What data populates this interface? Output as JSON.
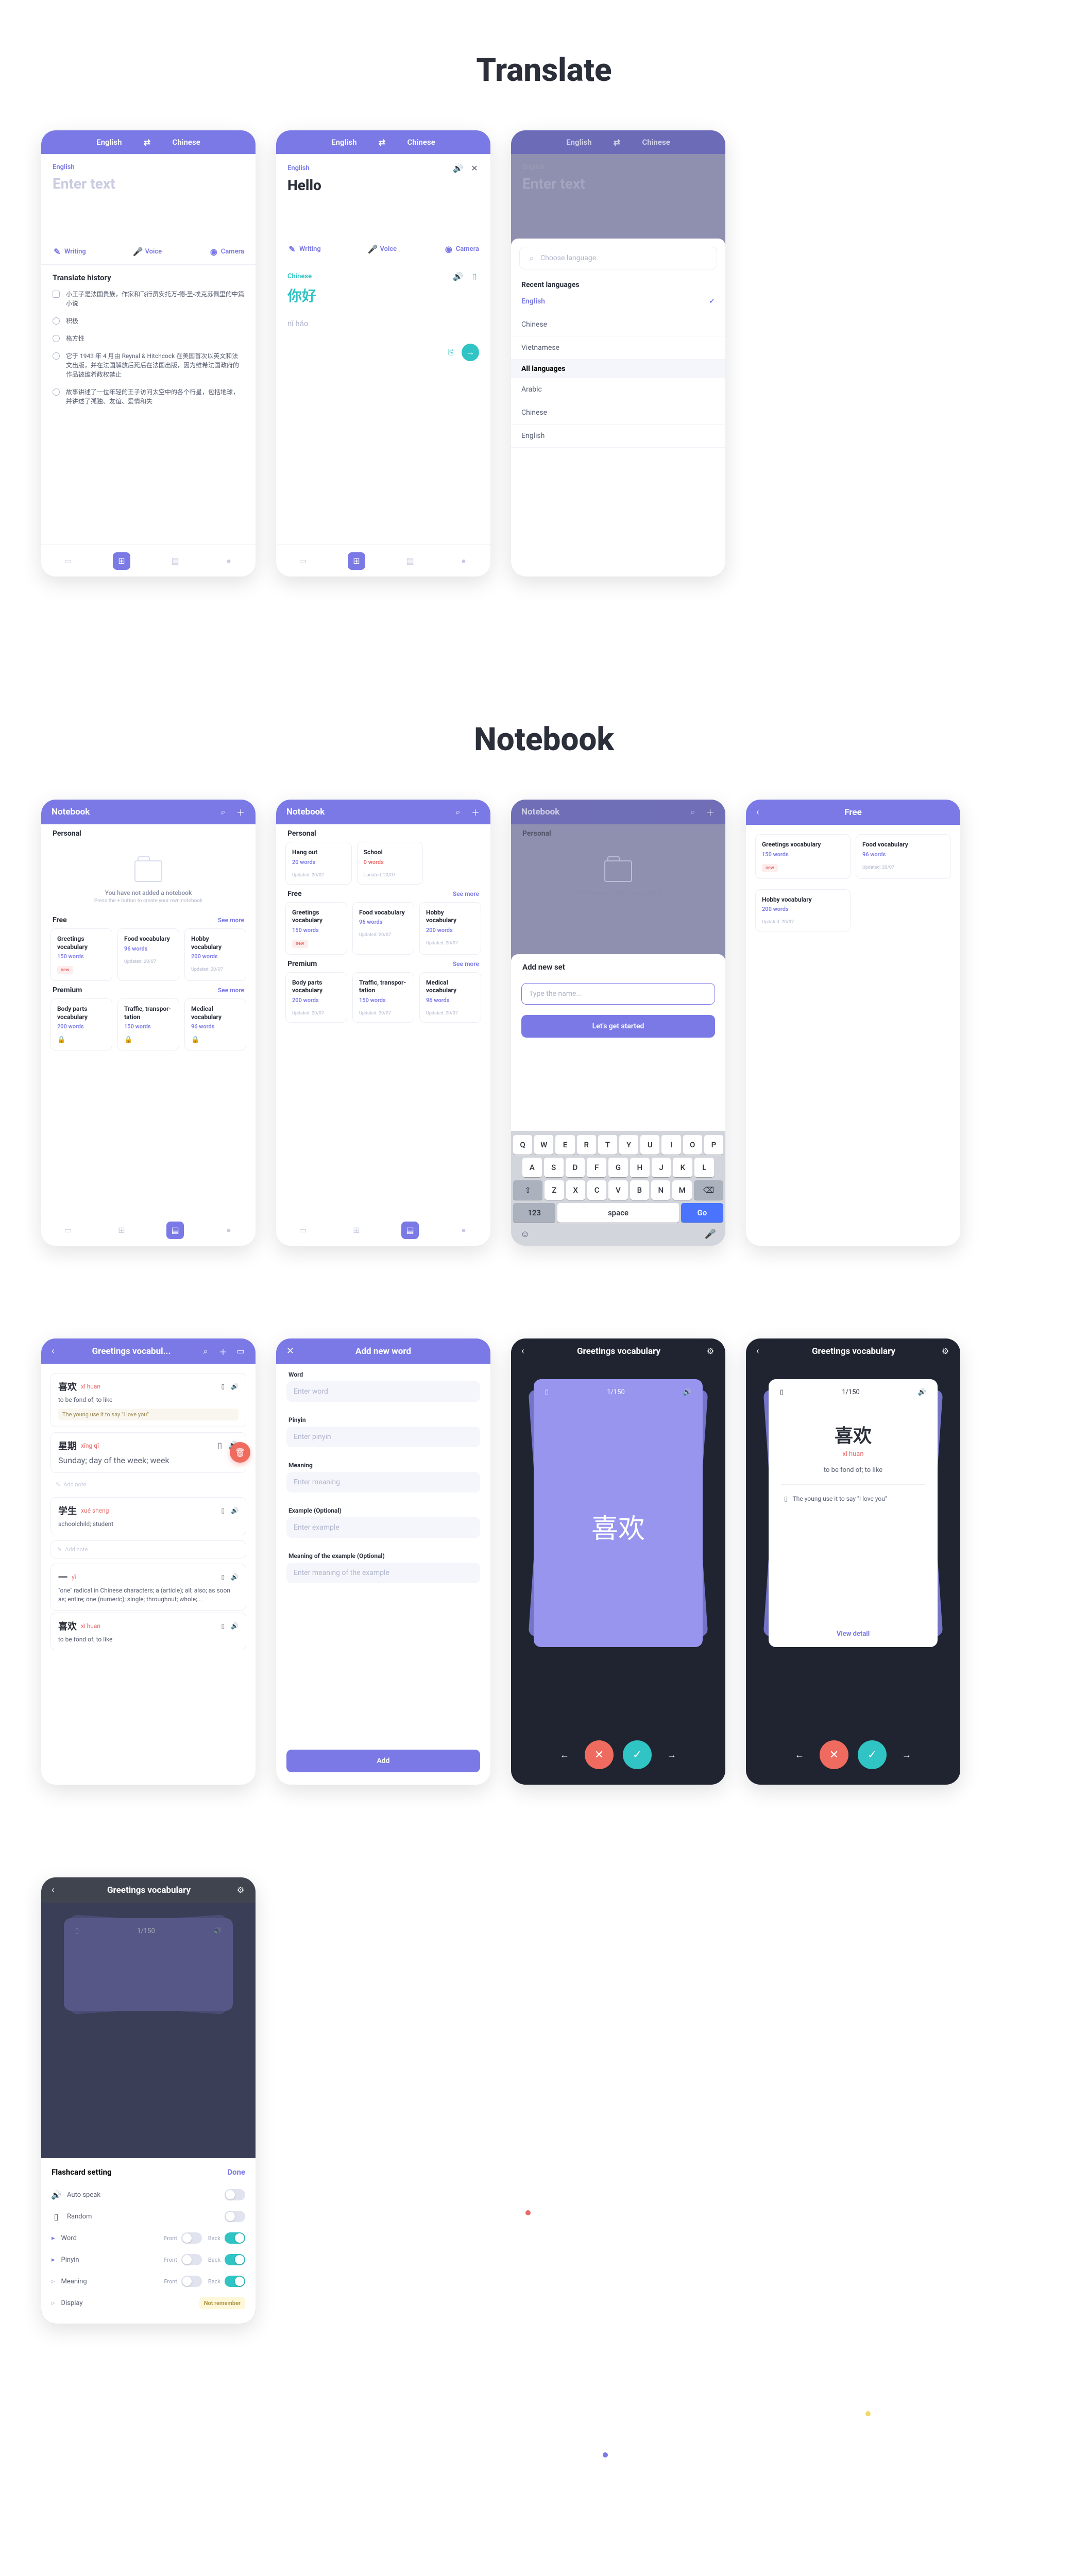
{
  "sections": {
    "translate": "Translate",
    "notebook": "Notebook"
  },
  "langs": {
    "en": "English",
    "cn": "Chinese"
  },
  "placeholders": {
    "enter_text": "Enter text",
    "choose_lang": "Choose language",
    "type_name": "Type the name...",
    "enter_word": "Enter word",
    "enter_pinyin": "Enter pinyin",
    "enter_meaning": "Enter meaning",
    "enter_example": "Enter example",
    "enter_example_meaning": "Enter meaning of the example",
    "add_note": "Add note"
  },
  "tools": {
    "writing": "Writing",
    "voice": "Voice",
    "camera": "Camera"
  },
  "translate_history_title": "Translate history",
  "history": [
    "小王子是法国贵族，作家和飞行员安托万-德-圣-埃克苏佩里的中篇小说",
    "积极",
    "格方性",
    "它于 1943 年 4 月由 Reynal & Hitchcock 在美国首次以英文和法文出版，并在法国解放后死后在法国出版，因为维希法国政府的作品被维希政权禁止",
    "故事讲述了一位年轻的王子访问太空中的各个行星，包括地球，并讲述了孤独、友谊、爱情和失"
  ],
  "sample": {
    "hello": "Hello",
    "nihao": "你好",
    "nihao_py": "nǐ hǎo"
  },
  "lang_picker": {
    "recent": "Recent languages",
    "all": "All languages",
    "recent_items": [
      "English",
      "Chinese",
      "Vietnamese"
    ],
    "all_items": [
      "Arabic",
      "Chinese",
      "English"
    ]
  },
  "notebook_hdr": "Notebook",
  "empty": {
    "t": "You have not added a notebook",
    "s": "Press the + button to create your own notebook"
  },
  "tiers": {
    "personal": "Personal",
    "free": "Free",
    "premium": "Premium",
    "see_more": "See more"
  },
  "personal_sets": [
    {
      "t": "Hang out",
      "w": "20 words",
      "u": "Updated: 20/07"
    },
    {
      "t": "School",
      "w": "0 words",
      "u": "Updated: 20/07",
      "red": true
    }
  ],
  "free_sets": [
    {
      "t": "Greetings vocabulary",
      "w": "150 words",
      "new": true
    },
    {
      "t": "Food vocabulary",
      "w": "96 words",
      "u": "Updated: 20/07"
    },
    {
      "t": "Hobby vocabulary",
      "w": "200 words",
      "u": "Updated: 20/07"
    }
  ],
  "premium_sets": [
    {
      "t": "Body parts vocabulary",
      "w": "200 words",
      "u": "Updated: 20/07"
    },
    {
      "t": "Traffic, transpor-tation",
      "w": "150 words",
      "u": "Updated: 20/07"
    },
    {
      "t": "Medical vocabulary",
      "w": "96 words",
      "u": "Updated: 20/07"
    }
  ],
  "new_tag": "new",
  "add_set": {
    "title": "Add new set",
    "cta": "Let's get started"
  },
  "keyboard": {
    "r1": [
      "Q",
      "W",
      "E",
      "R",
      "T",
      "Y",
      "U",
      "I",
      "O",
      "P"
    ],
    "r2": [
      "A",
      "S",
      "D",
      "F",
      "G",
      "H",
      "J",
      "K",
      "L"
    ],
    "r3": [
      "Z",
      "X",
      "C",
      "V",
      "B",
      "N",
      "M"
    ],
    "num": "123",
    "space": "space",
    "go": "Go"
  },
  "free_page_title": "Free",
  "add_word": {
    "title": "Add new word",
    "word": "Word",
    "pinyin": "Pinyin",
    "meaning": "Meaning",
    "example": "Example (Optional)",
    "example_meaning": "Meaning of the example (Optional)",
    "add": "Add"
  },
  "vocab_title_short": "Greetings vocabul...",
  "vocab_title_full": "Greetings vocabulary",
  "vocab": [
    {
      "cn": "喜欢",
      "py": "xǐ huan",
      "def": "to be fond of; to like",
      "ex": "The young use it to say \"I love you\""
    },
    {
      "cn": "星期",
      "py": "xīng qī",
      "def": "Sunday; day of the week; week"
    },
    {
      "cn": "学生",
      "py": "xué sheng",
      "def": "schoolchild; student"
    },
    {
      "cn": "一",
      "py": "yī",
      "def": "\"one\" radical in Chinese characters; a (article); all; also; as soon as; entire; one (numeric); single; throughout; whole;..."
    },
    {
      "cn": "喜欢",
      "py": "xǐ huan",
      "def": "to be fond of; to like"
    }
  ],
  "flash": {
    "count": "1/150",
    "cn": "喜欢",
    "py": "xǐ huan",
    "def": "to be fond of; to like",
    "ex": "The young use it to say \"I love you\"",
    "view": "View detail"
  },
  "settings": {
    "title": "Flashcard setting",
    "done": "Done",
    "auto_speak": "Auto speak",
    "random": "Random",
    "word": "Word",
    "pinyin": "Pinyin",
    "meaning": "Meaning",
    "display": "Display",
    "front": "Front",
    "back": "Back",
    "not_remember": "Not remember"
  }
}
